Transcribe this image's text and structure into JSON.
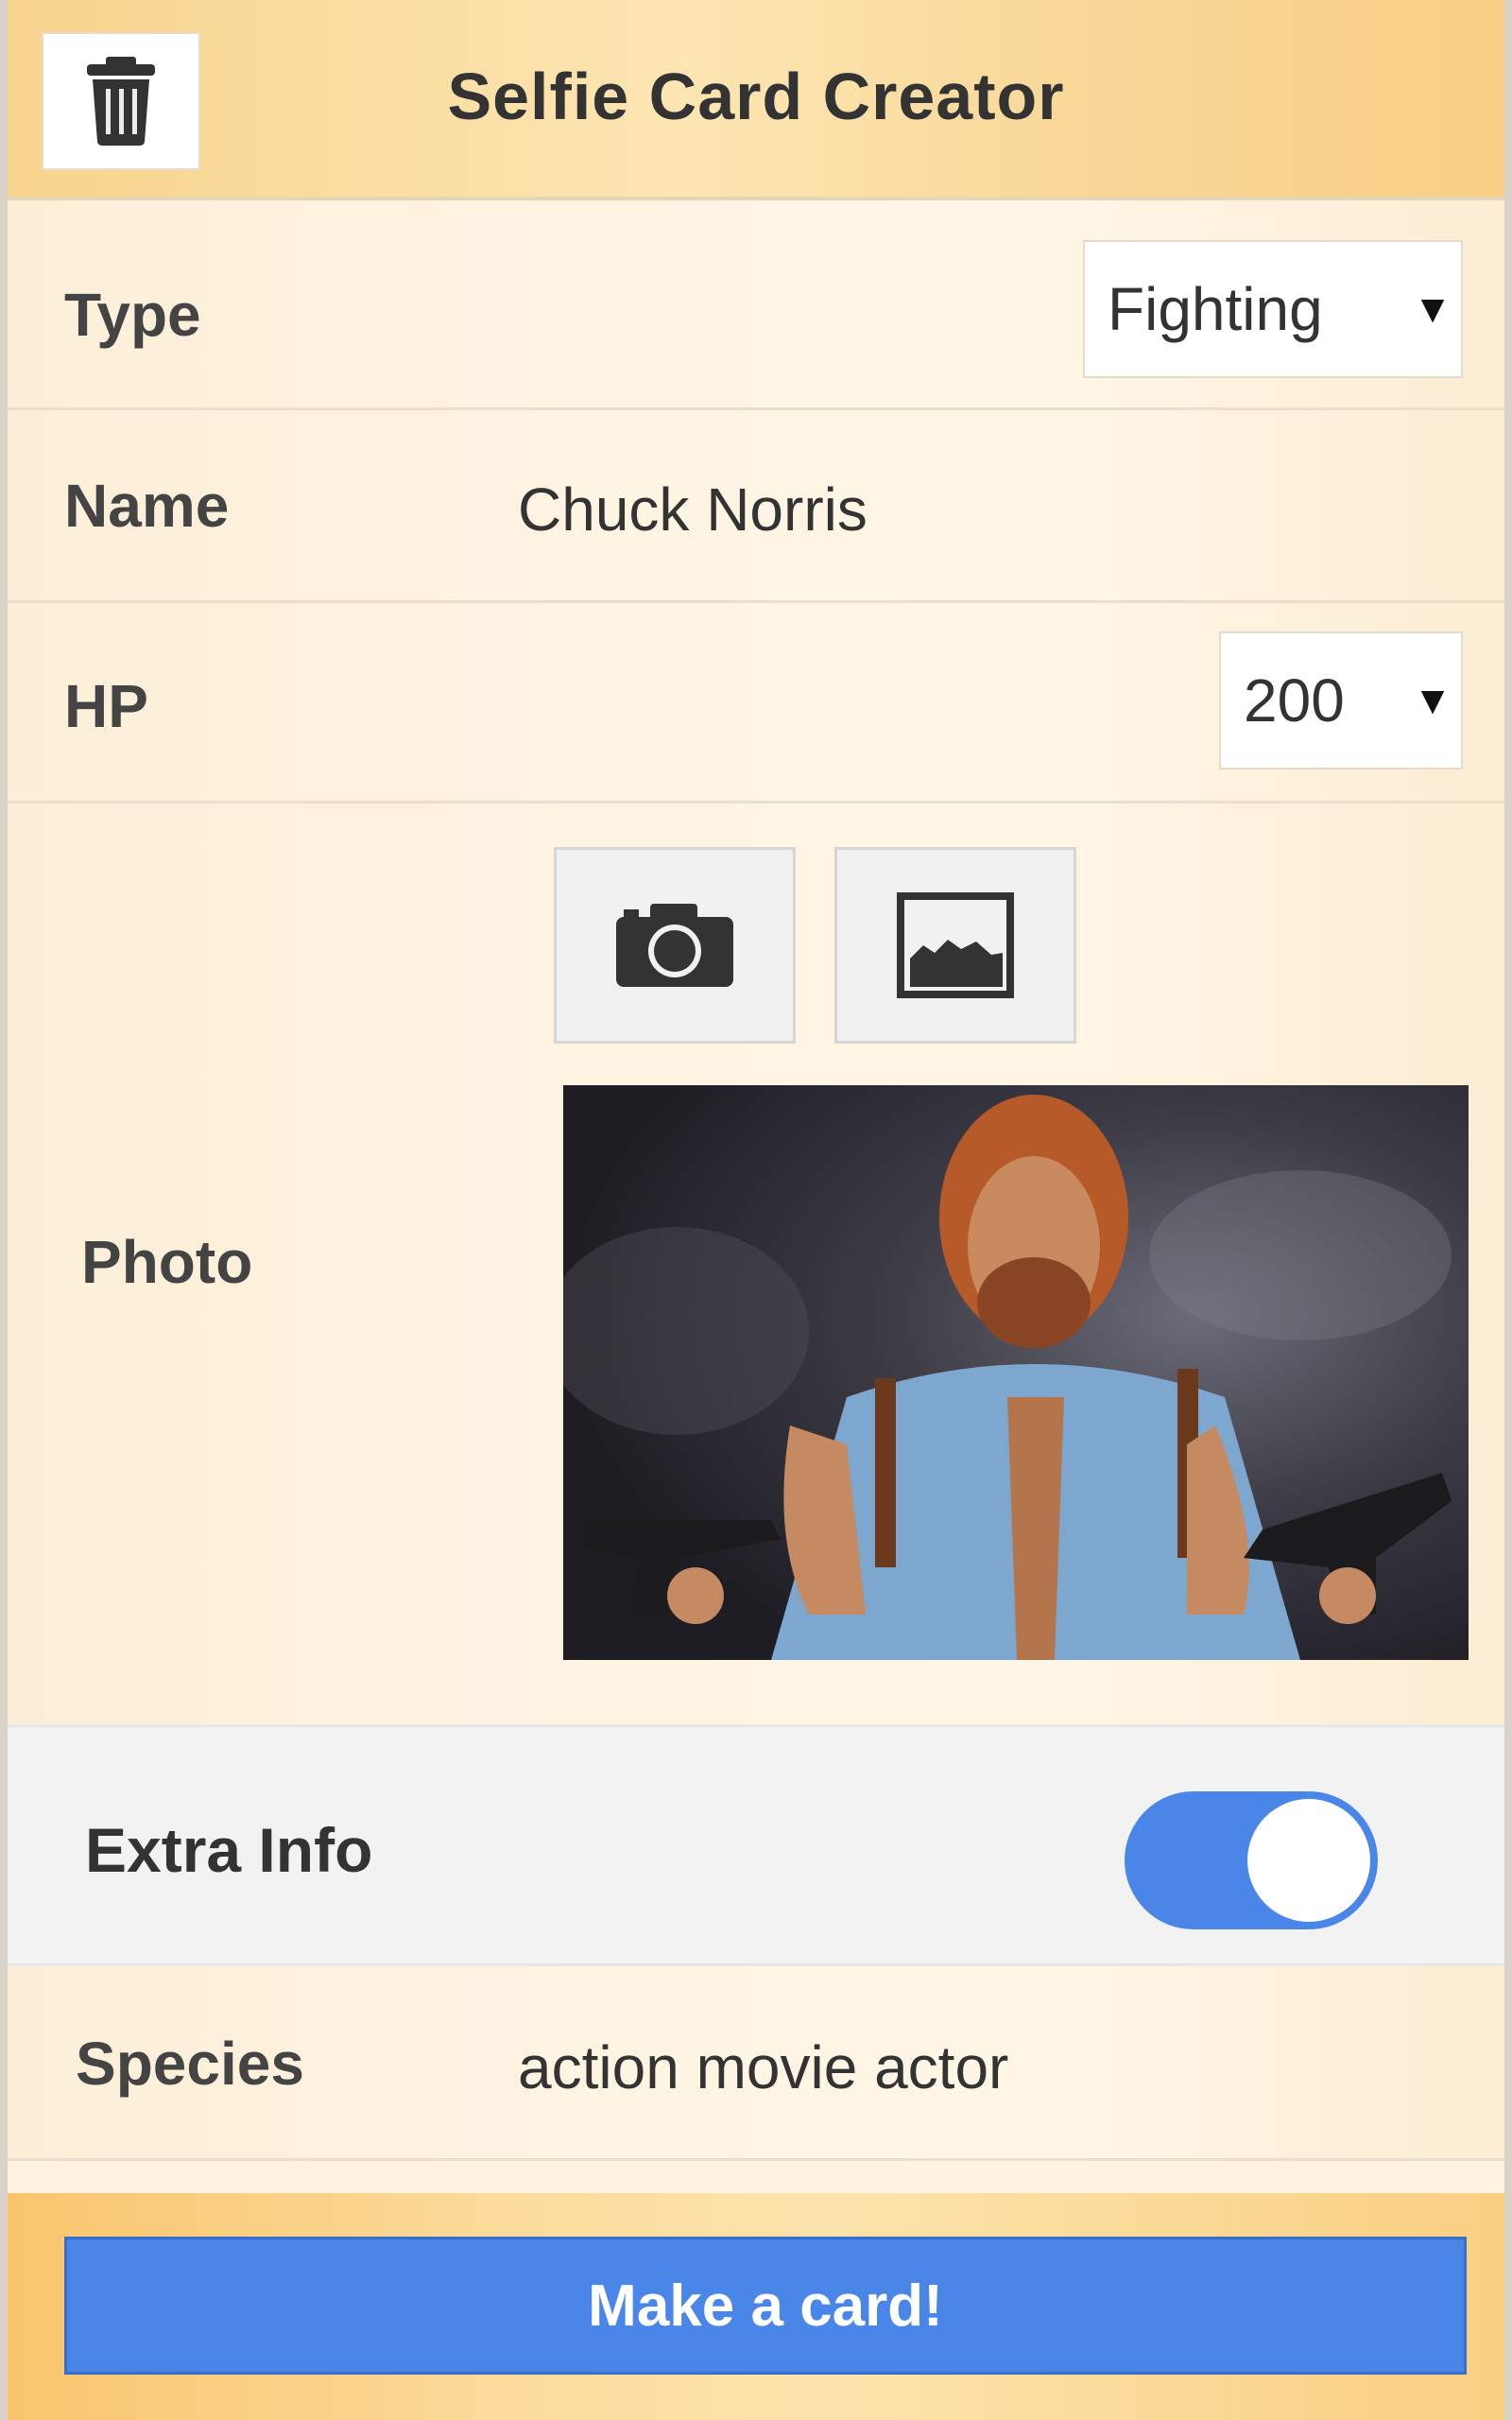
{
  "header": {
    "title": "Selfie Card Creator",
    "trash_icon": "trash-icon"
  },
  "form": {
    "type": {
      "label": "Type",
      "selected": "Fighting"
    },
    "name": {
      "label": "Name",
      "value": "Chuck Norris"
    },
    "hp": {
      "label": "HP",
      "selected": "200"
    },
    "photo": {
      "label": "Photo",
      "camera_icon": "camera-icon",
      "gallery_icon": "image-icon"
    },
    "extra": {
      "label": "Extra Info",
      "enabled": true
    },
    "species": {
      "label": "Species",
      "value": "action movie actor"
    }
  },
  "footer": {
    "make_button": "Make a card!"
  },
  "colors": {
    "accent": "#4a86e8",
    "header": "#f9d899"
  }
}
